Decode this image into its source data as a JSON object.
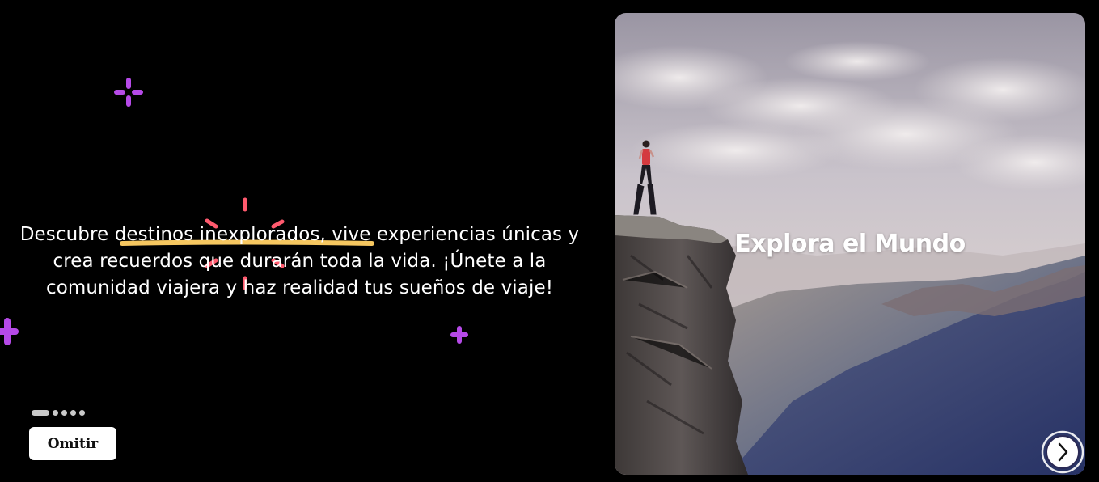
{
  "onboarding": {
    "description": "Descubre destinos inexplorados, vive experiencias únicas y crea recuerdos que durarán toda la vida. ¡Únete a la comunidad viajera y haz realidad tus sueños de viaje!",
    "skip_label": "Omitir",
    "slide_count": 5,
    "active_slide": 1
  },
  "hero": {
    "title": "Explora el Mundo"
  },
  "icons": {
    "next": "chevron-right-icon",
    "sparkle": "sparkle-icon",
    "burst": "burst-icon"
  },
  "colors": {
    "background": "#000000",
    "sparkle": "#b64ae8",
    "burst": "#ff5a6e",
    "underline": "#f6c760",
    "button_bg": "#ffffff"
  }
}
